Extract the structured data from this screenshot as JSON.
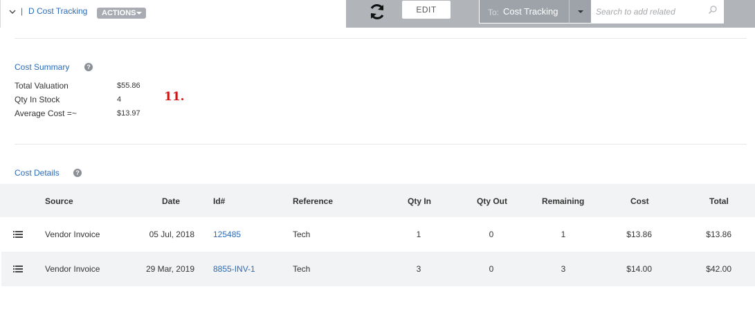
{
  "header": {
    "record_title": "D Cost Tracking",
    "actions_label": "ACTIONS",
    "edit_label": "EDIT",
    "to_prefix": "To:",
    "to_value": "Cost Tracking",
    "search_placeholder": "Search to add related"
  },
  "summary": {
    "title": "Cost Summary",
    "rows": [
      {
        "label": "Total Valuation",
        "value": "$55.86"
      },
      {
        "label": "Qty In Stock",
        "value": "4"
      },
      {
        "label": "Average Cost =~",
        "value": "$13.97"
      }
    ],
    "annotation": "11."
  },
  "details": {
    "title": "Cost Details",
    "columns": [
      "Source",
      "Date",
      "Id#",
      "Reference",
      "Qty In",
      "Qty Out",
      "Remaining",
      "Cost",
      "Total"
    ],
    "rows": [
      {
        "source": "Vendor Invoice",
        "date": "05 Jul, 2018",
        "id": "125485",
        "reference": "Tech",
        "qty_in": "1",
        "qty_out": "0",
        "remaining": "1",
        "cost": "$13.86",
        "total": "$13.86"
      },
      {
        "source": "Vendor Invoice",
        "date": "29 Mar, 2019",
        "id": "8855-INV-1",
        "reference": "Tech",
        "qty_in": "3",
        "qty_out": "0",
        "remaining": "3",
        "cost": "$14.00",
        "total": "$42.00"
      }
    ]
  },
  "icons": {
    "collapse": "chevron-down-icon",
    "refresh": "refresh-icon",
    "search": "search-icon",
    "help": "help-icon",
    "row_menu": "list-icon"
  },
  "colors": {
    "link": "#2a6ab8",
    "toolbar": "#b1b5ba",
    "annotation": "#d01515"
  }
}
